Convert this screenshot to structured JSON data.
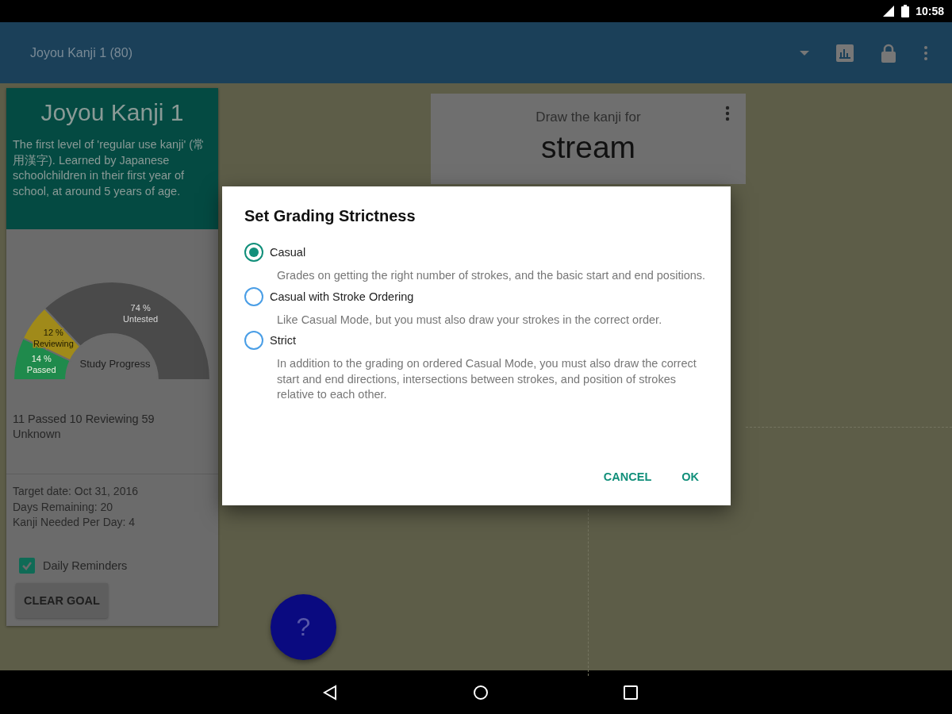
{
  "status_bar": {
    "time": "10:58"
  },
  "app_bar": {
    "title": "Joyou Kanji 1 (80)"
  },
  "deck_card": {
    "title": "Joyou Kanji 1",
    "description": "The first level of 'regular use kanji' (常用漢字). Learned by Japanese schoolchildren in their first year of school, at around 5 years of age.",
    "chart_data": {
      "type": "donut",
      "title": "Study Progress",
      "categories": [
        "Passed",
        "Reviewing",
        "Untested"
      ],
      "series": [
        {
          "values": [
            14,
            12,
            74
          ]
        }
      ],
      "value_labels": [
        "14 %",
        "12 %",
        "74 %"
      ]
    },
    "summary": "11 Passed 10 Reviewing 59 Unknown",
    "goal_lines": [
      "Target date: Oct 31, 2016",
      "Days Remaining: 20",
      "Kanji Needed Per Day: 4"
    ],
    "daily_reminders": {
      "label": "Daily Reminders",
      "checked": true
    },
    "clear_goal_button": "CLEAR GOAL"
  },
  "prompt_card": {
    "caption": "Draw the kanji for",
    "word": "stream"
  },
  "fab": {
    "label": "?"
  },
  "dialog": {
    "title": "Set Grading Strictness",
    "options": [
      {
        "label": "Casual",
        "selected": true,
        "description": "Grades on getting the right number of strokes, and the basic start and end positions."
      },
      {
        "label": "Casual with Stroke Ordering",
        "selected": false,
        "description": "Like Casual Mode, but you must also draw your strokes in the correct order."
      },
      {
        "label": "Strict",
        "selected": false,
        "description": "In addition to the grading on ordered Casual Mode, you must also draw the correct start and end directions, intersections between strokes, and position of strokes relative to each other."
      }
    ],
    "buttons": [
      "CANCEL",
      "OK"
    ]
  }
}
